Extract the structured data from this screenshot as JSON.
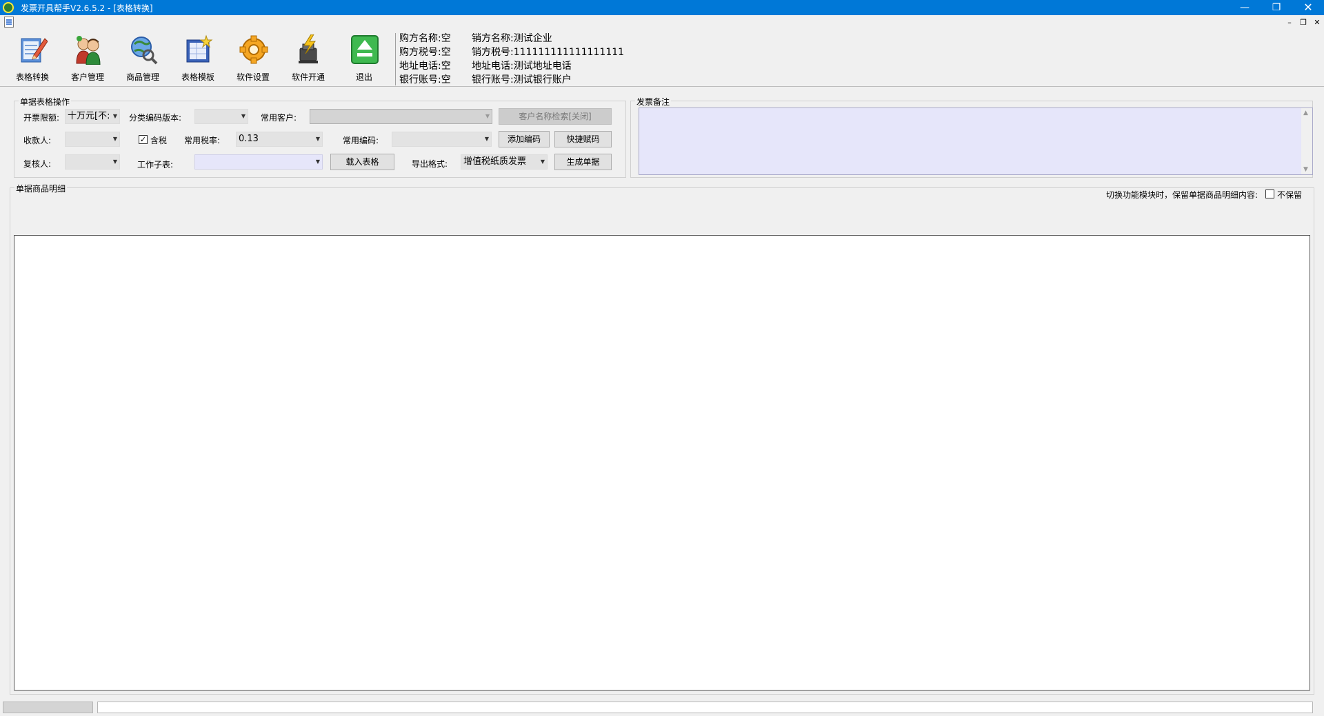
{
  "window": {
    "title": "发票开具帮手V2.6.5.2  - [表格转换]",
    "controls": {
      "minimize": "—",
      "restore": "❐",
      "close": "✕"
    },
    "mdi_controls": {
      "minimize": "–",
      "restore": "❐",
      "close": "✕"
    }
  },
  "toolbar": {
    "items": [
      {
        "label": "表格转换",
        "icon": "table-convert-icon"
      },
      {
        "label": "客户管理",
        "icon": "customer-manage-icon"
      },
      {
        "label": "商品管理",
        "icon": "product-manage-icon"
      },
      {
        "label": "表格模板",
        "icon": "table-template-icon"
      },
      {
        "label": "软件设置",
        "icon": "settings-gear-icon"
      },
      {
        "label": "软件开通",
        "icon": "activation-icon"
      },
      {
        "label": "退出",
        "icon": "exit-icon"
      }
    ]
  },
  "buyer": {
    "name_label": "购方名称:",
    "name_value": "空",
    "tax_label": "购方税号:",
    "tax_value": "空",
    "addr_label": "地址电话:",
    "addr_value": "空",
    "bank_label": "银行账号:",
    "bank_value": "空"
  },
  "seller": {
    "name_label": "销方名称:",
    "name_value": "测试企业",
    "tax_label": "销方税号:",
    "tax_value": "111111111111111111",
    "addr_label": "地址电话:",
    "addr_value": "测试地址电话",
    "bank_label": "银行账号:",
    "bank_value": "测试银行账户"
  },
  "ops": {
    "group_title": "单据表格操作",
    "limit_label": "开票限额:",
    "limit_value": "十万元[不:",
    "code_version_label": "分类编码版本:",
    "code_version_value": "",
    "common_customer_label": "常用客户:",
    "common_customer_value": "",
    "search_button": "客户名称检索[关闭]",
    "payee_label": "收款人:",
    "payee_value": "",
    "tax_inclusive_label": "含税",
    "tax_inclusive_checked": true,
    "tax_rate_label": "常用税率:",
    "tax_rate_value": "0.13",
    "common_code_label": "常用编码:",
    "common_code_value": "",
    "add_code_button": "添加编码",
    "quick_code_button": "快捷赋码",
    "reviewer_label": "复核人:",
    "reviewer_value": "",
    "sheet_label": "工作子表:",
    "sheet_value": "",
    "load_button": "载入表格",
    "export_label": "导出格式:",
    "export_value": "增值税纸质发票",
    "generate_button": "生成单据"
  },
  "remark": {
    "group_title": "发票备注",
    "value": ""
  },
  "detail": {
    "group_title": "单据商品明细",
    "keep_label": "切换功能模块时，保留单据商品明细内容:",
    "keep_option": "不保留",
    "keep_checked": false
  }
}
